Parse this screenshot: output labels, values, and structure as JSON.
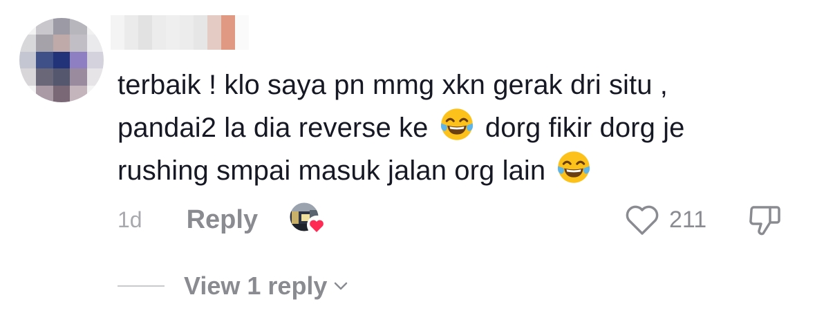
{
  "comment": {
    "text_lines": [
      "terbaik ! klo saya pn mmg xkn gerak dri situ ,",
      "pandai2 la dia reverse ke",
      " dorg fikir dorg je",
      "rushing smpai masuk jalan org lain"
    ],
    "time": "1d",
    "reply_label": "Reply",
    "like_count": "211",
    "view_replies_label": "View 1 reply",
    "icons": {
      "avatar": "blurred-avatar",
      "username": "blurred-username",
      "emoji": "face-with-tears-of-joy-emoji",
      "creator_liked": "creator-avatar-heart-icon",
      "like": "heart-outline-icon",
      "dislike": "thumbs-down-icon",
      "expand": "chevron-down-icon"
    },
    "colors": {
      "text": "#161823",
      "muted": "#8a8b91",
      "heart_badge": "#fe2c55"
    }
  }
}
